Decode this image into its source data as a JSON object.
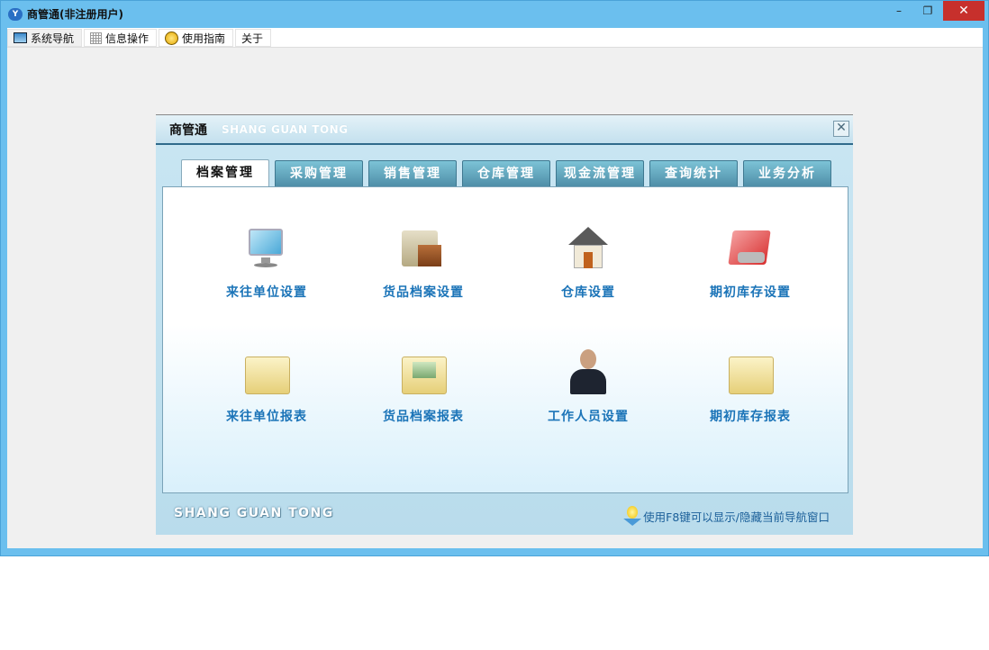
{
  "window": {
    "title": "商管通(非注册用户)",
    "controls": {
      "minimize": "–",
      "restore": "❐",
      "close": "✕"
    }
  },
  "menubar": [
    {
      "label": "系统导航",
      "icon": "monitor-icon"
    },
    {
      "label": "信息操作",
      "icon": "grid-icon"
    },
    {
      "label": "使用指南",
      "icon": "help-icon"
    },
    {
      "label": "关于"
    }
  ],
  "dialog": {
    "title": "商管通",
    "subtitle": "SHANG GUAN TONG",
    "close": "✕",
    "tabs": [
      "档案管理",
      "采购管理",
      "销售管理",
      "仓库管理",
      "现金流管理",
      "查询统计",
      "业务分析"
    ],
    "active_tab": "档案管理",
    "items": [
      {
        "label": "来往单位设置",
        "icon": "computer-icon"
      },
      {
        "label": "货品档案设置",
        "icon": "folder-box-icon"
      },
      {
        "label": "仓库设置",
        "icon": "house-icon"
      },
      {
        "label": "期初库存设置",
        "icon": "calculator-icon"
      },
      {
        "label": "来往单位报表",
        "icon": "folder-icon"
      },
      {
        "label": "货品档案报表",
        "icon": "folder-image-icon"
      },
      {
        "label": "工作人员设置",
        "icon": "person-icon"
      },
      {
        "label": "期初库存报表",
        "icon": "folder-icon"
      }
    ],
    "footer": {
      "brand": "SHANG GUAN TONG",
      "hint": "使用F8键可以显示/隐藏当前导航窗口"
    }
  }
}
